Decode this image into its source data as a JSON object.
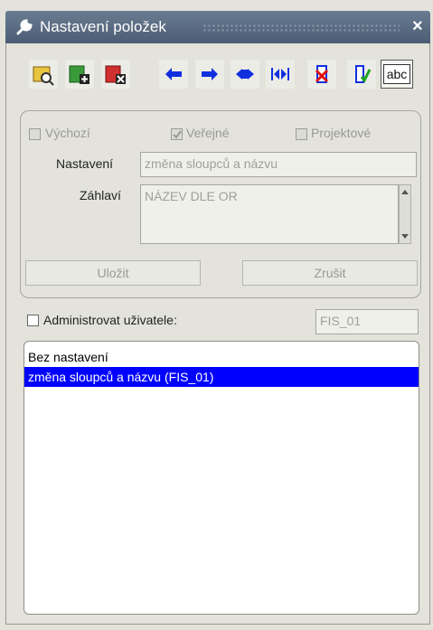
{
  "window": {
    "title": "Nastavení položek",
    "close_label": "×"
  },
  "toolbar": {
    "buttons": [
      {
        "name": "search-settings-icon"
      },
      {
        "name": "add-settings-icon"
      },
      {
        "name": "delete-settings-icon"
      },
      {
        "name": "arrow-left-icon"
      },
      {
        "name": "arrow-right-icon"
      },
      {
        "name": "toggle-visibility-icon"
      },
      {
        "name": "join-columns-icon"
      },
      {
        "name": "remove-column-icon"
      },
      {
        "name": "confirm-column-icon"
      },
      {
        "name": "text-style-icon",
        "label": "abc"
      }
    ]
  },
  "form": {
    "default_label": "Výchozí",
    "public_label": "Veřejné",
    "project_label": "Projektové",
    "settings_label": "Nastavení",
    "settings_value": "změna sloupců a názvu",
    "header_label": "Záhlaví",
    "header_value": "NÁZEV DLE OR",
    "save_label": "Uložit",
    "cancel_label": "Zrušit"
  },
  "admin": {
    "checkbox_label": "Administrovat uživatele:",
    "user_value": "FIS_01"
  },
  "settings_list": {
    "items": [
      {
        "label": "Bez nastavení",
        "selected": false
      },
      {
        "label": "změna sloupců a názvu  (FIS_01)",
        "selected": true
      }
    ]
  },
  "colors": {
    "selection": "#0000ff",
    "titlebar": "#4c5d73"
  }
}
